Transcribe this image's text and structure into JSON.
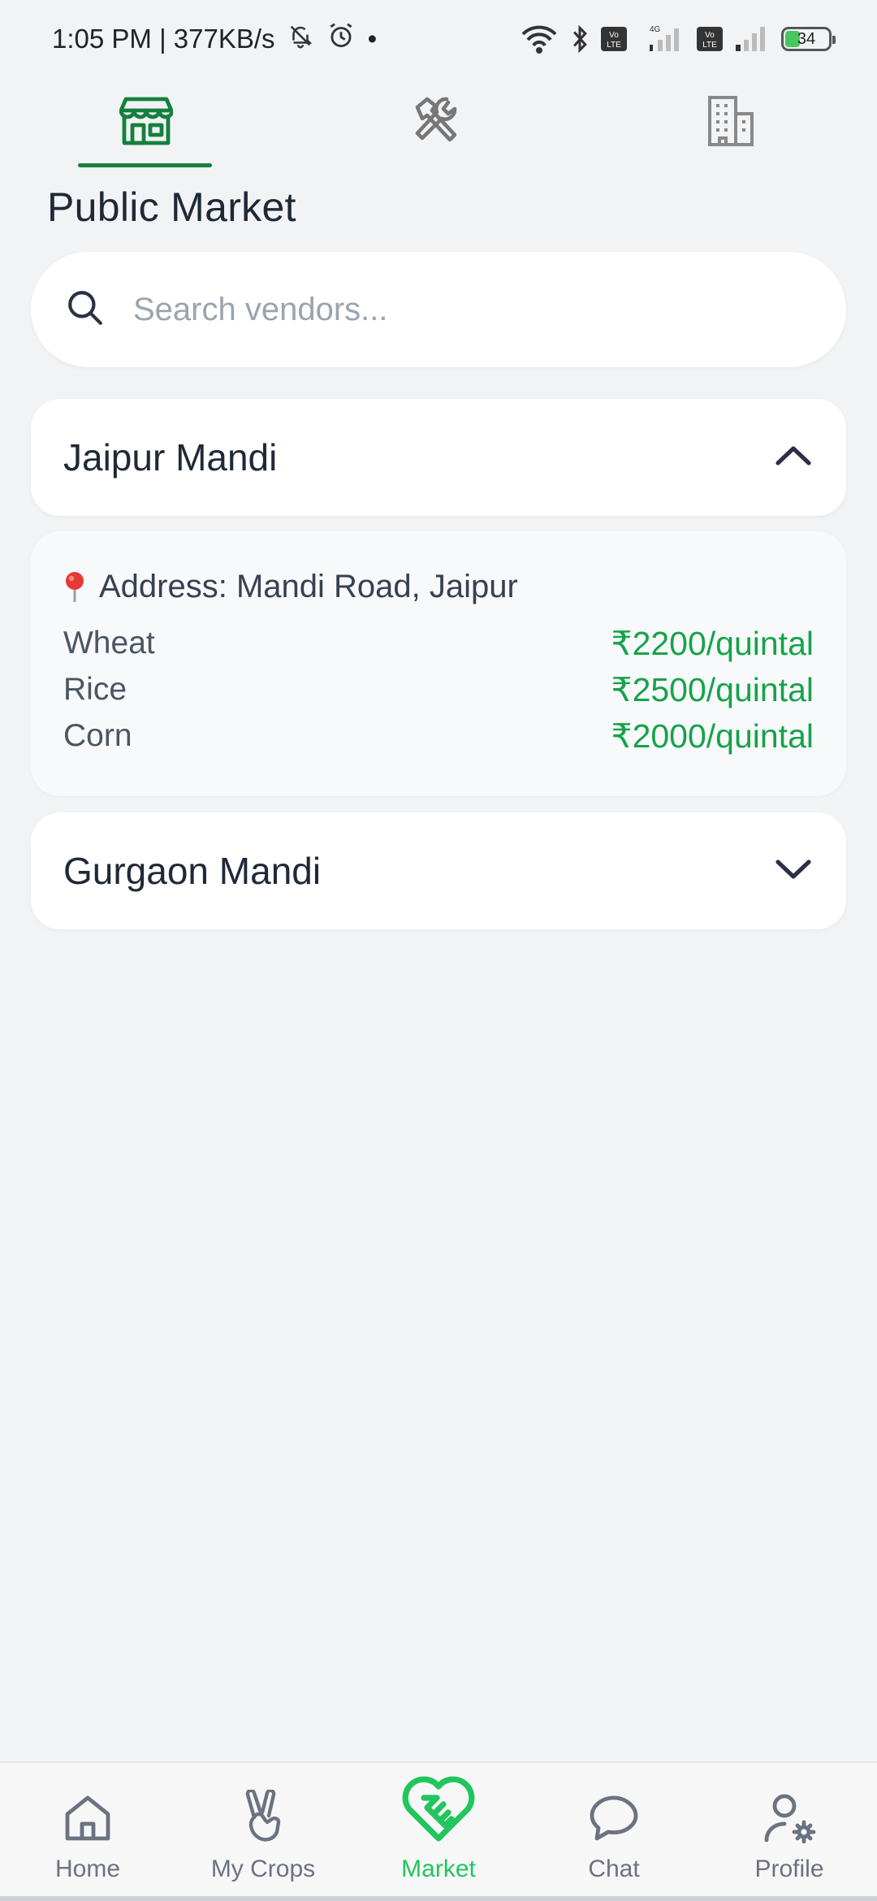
{
  "status_bar": {
    "time_speed": "1:05 PM | 377KB/s",
    "dot": "•",
    "network_label": "4G",
    "volte_label": "Vo LTE",
    "battery_level": "34"
  },
  "top_tabs": [
    {
      "icon": "storefront-icon",
      "active": true
    },
    {
      "icon": "tools-icon",
      "active": false
    },
    {
      "icon": "building-icon",
      "active": false
    }
  ],
  "page": {
    "title": "Public Market"
  },
  "search": {
    "placeholder": "Search vendors...",
    "value": ""
  },
  "markets": [
    {
      "name": "Jaipur Mandi",
      "expanded": true,
      "address": "Address: Mandi Road, Jaipur",
      "prices": [
        {
          "crop": "Wheat",
          "price": "₹2200/quintal"
        },
        {
          "crop": "Rice",
          "price": "₹2500/quintal"
        },
        {
          "crop": "Corn",
          "price": "₹2000/quintal"
        }
      ]
    },
    {
      "name": "Gurgaon Mandi",
      "expanded": false
    }
  ],
  "bottom_nav": [
    {
      "label": "Home",
      "icon": "home-icon",
      "active": false
    },
    {
      "label": "My Crops",
      "icon": "peace-hand-icon",
      "active": false
    },
    {
      "label": "Market",
      "icon": "handshake-heart-icon",
      "active": true
    },
    {
      "label": "Chat",
      "icon": "chat-bubble-icon",
      "active": false
    },
    {
      "label": "Profile",
      "icon": "profile-settings-icon",
      "active": false
    }
  ],
  "colors": {
    "accent_green": "#15803d",
    "price_green": "#16a34a",
    "active_nav_green": "#22c55e",
    "background": "#f2f3f5"
  }
}
